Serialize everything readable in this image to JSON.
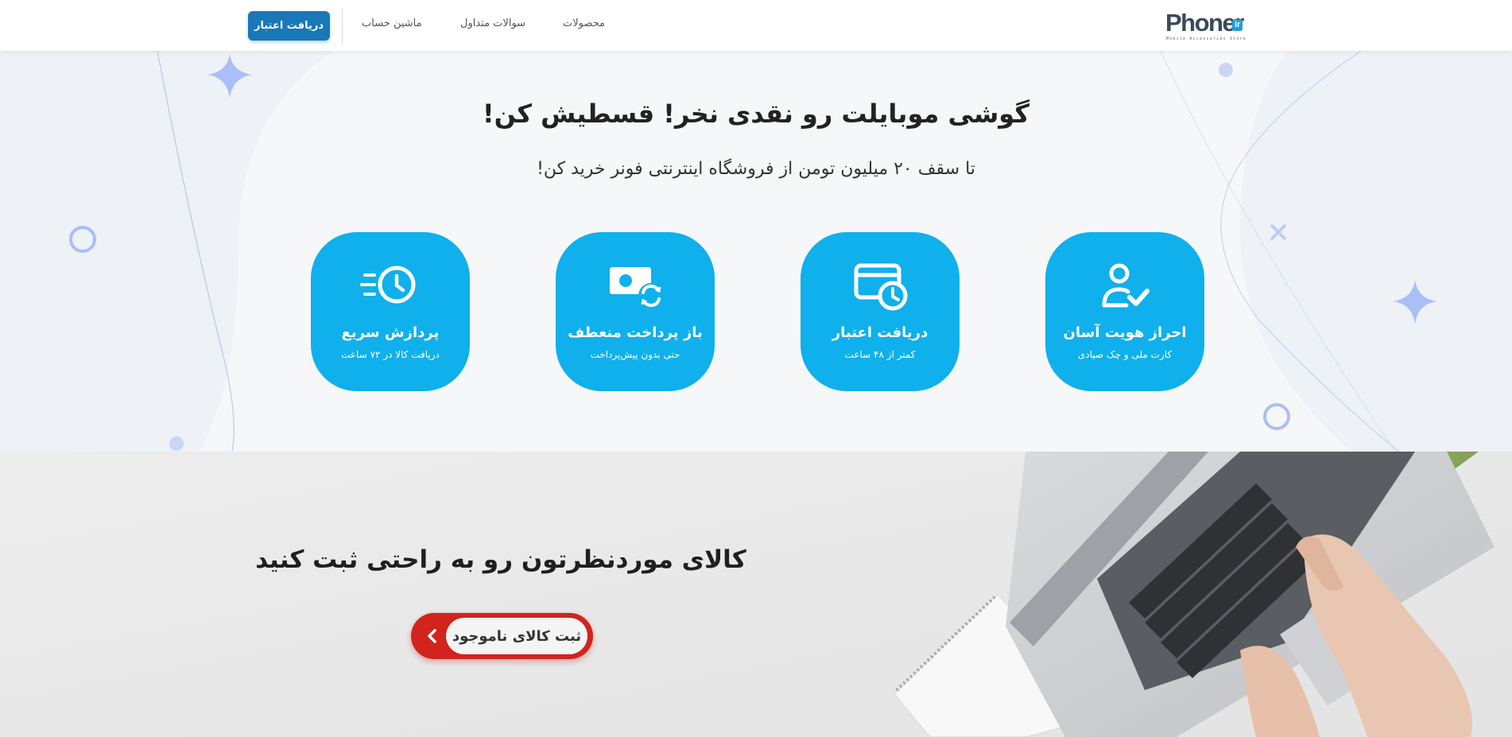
{
  "header": {
    "logo": {
      "name": "Phoner",
      "badge": "ir",
      "tagline": "Mobile Accessories Store"
    },
    "nav": [
      {
        "label": "محصولات"
      },
      {
        "label": "سوالات متداول"
      },
      {
        "label": "ماشین حساب"
      }
    ],
    "cta_label": "دریافت اعتبار"
  },
  "hero": {
    "title": "گوشی موبایلت رو نقدی نخر! قسطیش کن!",
    "subtitle": "تا سقف ۲۰ میلیون تومن از فروشگاه اینترنتی فونر خرید کن!",
    "features": [
      {
        "title": "احراز هویت آسان",
        "subtitle": "کارت ملی و چک صیادی",
        "icon": "user-check-icon"
      },
      {
        "title": "دریافت اعتبار",
        "subtitle": "کمتر از ۴۸ ساعت",
        "icon": "card-clock-icon"
      },
      {
        "title": "باز پرداخت منعطف",
        "subtitle": "حتی بدون پیش‌پرداخت",
        "icon": "money-refresh-icon"
      },
      {
        "title": "پردازش سریع",
        "subtitle": "دریافت کالا در ۷۲ ساعت",
        "icon": "fast-clock-icon"
      }
    ]
  },
  "request": {
    "title": "کالای موردنظرتون رو به راحتی ثبت کنید",
    "button_label": "ثبت کالای ناموجود"
  },
  "colors": {
    "primary": "#1878b8",
    "feature_card": "#0fb0ec",
    "cta_red": "#d2231d",
    "decoration": "#a9bff5"
  }
}
